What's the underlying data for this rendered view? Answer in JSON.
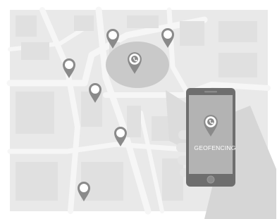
{
  "phone_screen_text": "GEOFENCING",
  "colors": {
    "map_block": "#e6e6e6",
    "road": "#f4f4f4",
    "geofence_zone": "#c9c9c9",
    "pin": "#8a8a8a",
    "phone_body": "#6e6e6e",
    "phone_screen": "#b3b3b3",
    "hand": "#dadada"
  },
  "icons": [
    "map-pin-icon",
    "geofence-zone",
    "smartphone-icon",
    "hand-illustration"
  ]
}
